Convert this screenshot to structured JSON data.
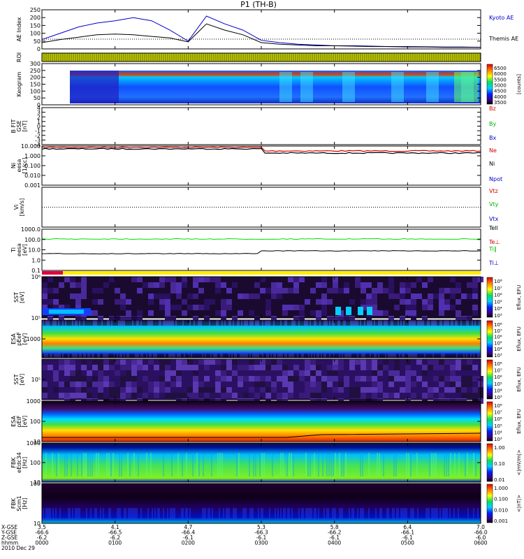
{
  "title": "P1 (TH-B)",
  "footer_date": "2010 Dec 29",
  "colors": {
    "kyoto": "#0000c8",
    "themis": "#000000",
    "red": "#d20000",
    "green": "#00b400",
    "blue": "#0000c8",
    "bright_green": "#00e000"
  },
  "panels": [
    {
      "ylabel": [
        "AE Index"
      ],
      "ticks": [
        "250",
        "200",
        "150",
        "100",
        "50",
        "0"
      ],
      "right": [
        "Kyoto AE",
        "Themis AE"
      ]
    },
    {
      "ylabel": [
        "ROI"
      ]
    },
    {
      "ylabel": [
        "Keogram"
      ],
      "ticks": [
        "300",
        "250",
        "200",
        "150",
        "100",
        "50",
        "0"
      ],
      "cbar_ticks": [
        "6500",
        "6000",
        "5500",
        "5000",
        "4500",
        "4000",
        "3500"
      ],
      "cbar_label": "[counts]"
    },
    {
      "ylabel": [
        "B FIT",
        "GSE",
        "[nT]"
      ],
      "ticks": [
        "4",
        "3",
        "2",
        "1",
        "0",
        "-1",
        "-2",
        "-3",
        "-4"
      ],
      "right": [
        "Bz",
        "By",
        "Bx"
      ]
    },
    {
      "ylabel": [
        "Ni",
        "eesa",
        "[1/cc]"
      ],
      "ticks": [
        "10.000",
        "1.000",
        "0.100",
        "0.010",
        "0.001"
      ],
      "right": [
        "Ne",
        "Ni",
        "Npot"
      ]
    },
    {
      "ylabel": [
        "Vi",
        "[km/s]"
      ],
      "right": [
        "Vtz",
        "Vty",
        "Vtx"
      ]
    },
    {
      "ylabel": [
        "Ti",
        "eesa",
        "[eV]"
      ],
      "ticks": [
        "1000.0",
        "100.0",
        "10.0",
        "1.0",
        "0.1"
      ],
      "right": [
        "Tell",
        "Te⊥",
        "Ti∥",
        "Ti⊥"
      ]
    },
    {
      "ylabel": [
        "SST",
        "[eV]"
      ],
      "ticks": [
        "10⁶",
        "10⁵"
      ],
      "cbar_ticks": [
        "10⁸",
        "10⁷",
        "10⁶",
        "10⁵",
        "10⁴",
        "10³"
      ],
      "cbar_label": "Eflux, EFU"
    },
    {
      "ylabel": [
        "ESA",
        "pEeF",
        "[eV]"
      ],
      "ticks": [
        "1000"
      ],
      "cbar_ticks": [
        "10⁸",
        "10⁷",
        "10⁶",
        "10⁵",
        "10⁴",
        "10³"
      ],
      "cbar_label": "Eflux, EFU"
    },
    {
      "ylabel": [
        "SST",
        "[eV]"
      ],
      "ticks": [
        "10⁵"
      ],
      "cbar_ticks": [
        "10⁸",
        "10⁷",
        "10⁶",
        "10⁵",
        "10⁴",
        "10³"
      ],
      "cbar_label": "Eflux, EFU"
    },
    {
      "ylabel": [
        "ESA",
        "pEiF",
        "[eV]"
      ],
      "ticks": [
        "1000",
        "100",
        "10"
      ],
      "cbar_ticks": [
        "10⁸",
        "10⁷",
        "10⁶",
        "10⁵",
        "10⁴",
        "10³"
      ],
      "cbar_label": "Eflux, EFU"
    },
    {
      "ylabel": [
        "FBK",
        "eEdc34",
        "[Hz]"
      ],
      "ticks": [
        "1000",
        "100",
        "10"
      ],
      "cbar_ticks": [
        "1.00",
        "0.10",
        "0.01"
      ],
      "cbar_label": "<|mV/m|>"
    },
    {
      "ylabel": [
        "FBK",
        "Scm1",
        "[Hz]"
      ],
      "ticks": [
        "100",
        "10"
      ],
      "cbar_ticks": [
        "1.000",
        "0.100",
        "0.010",
        "0.001"
      ],
      "cbar_label": "<|nT|>"
    }
  ],
  "x_axis": {
    "row_labels": [
      "X-GSE",
      "Y-GSE",
      "Z-GSE",
      "hhmm",
      "2010 Dec 29"
    ],
    "columns": [
      {
        "x": "3.5",
        "y": "-66.6",
        "z": "-6.2",
        "t": "0000"
      },
      {
        "x": "4.1",
        "y": "-66.5",
        "z": "-6.2",
        "t": "0100"
      },
      {
        "x": "4.7",
        "y": "-66.4",
        "z": "-6.1",
        "t": "0200"
      },
      {
        "x": "5.3",
        "y": "-66.3",
        "z": "-6.1",
        "t": "0300"
      },
      {
        "x": "5.8",
        "y": "-66.2",
        "z": "-6.1",
        "t": "0400"
      },
      {
        "x": "6.4",
        "y": "-66.1",
        "z": "-6.1",
        "t": "0500"
      },
      {
        "x": "7.0",
        "y": "-66.0",
        "z": "-6.0",
        "t": "0600"
      }
    ]
  },
  "chart_data": {
    "type": "line",
    "title": "P1 (TH-B)",
    "xlabel": "hhmm",
    "categories": [
      "0000",
      "0100",
      "0200",
      "0300",
      "0400",
      "0500",
      "0600"
    ],
    "ylabel": "AE Index",
    "ylim": [
      0,
      250
    ],
    "series": [
      {
        "name": "Kyoto AE",
        "values": [
          60,
          100,
          140,
          165,
          180,
          200,
          180,
          120,
          50,
          210,
          160,
          120,
          55,
          40,
          30,
          25,
          20,
          20,
          18,
          15,
          15,
          14,
          12,
          12,
          10
        ]
      },
      {
        "name": "Themis AE",
        "values": [
          40,
          60,
          75,
          90,
          95,
          90,
          80,
          70,
          45,
          160,
          120,
          90,
          40,
          30,
          25,
          20,
          20,
          18,
          15,
          15,
          12,
          12,
          10,
          10,
          10
        ]
      }
    ]
  }
}
